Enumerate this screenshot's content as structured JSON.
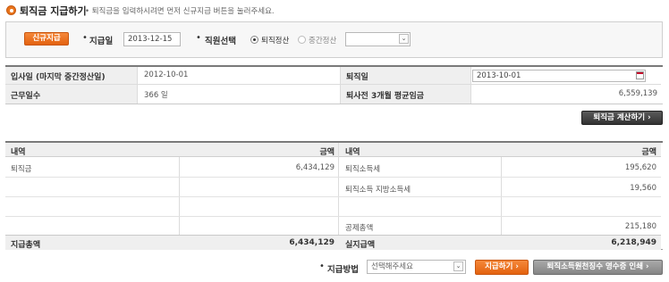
{
  "header": {
    "title": "퇴직금 지급하기",
    "description": "• 퇴직금을 입력하시려면 먼저 신규지급 버튼을 눌러주세요."
  },
  "search": {
    "new_payment_button": "신규지급",
    "pay_date_label": "지급일",
    "pay_date_value": "2013-12-15",
    "employee_select_label": "직원선택",
    "radio_retirement": "퇴직정산",
    "radio_interim": "중간정산",
    "employee_dropdown_value": ""
  },
  "info": {
    "join_date_label": "입사일 (마지막 중간정산일)",
    "join_date_value": "2012-10-01",
    "retire_date_label": "퇴직일",
    "retire_date_value": "2013-10-01",
    "service_days_label": "근무일수",
    "service_days_value": "366 일",
    "avg_wage_label": "퇴사전 3개월 평균임금",
    "avg_wage_value": "6,559,139",
    "calc_button": "퇴직금 계산하기"
  },
  "detail": {
    "left_headers": [
      "내역",
      "금액"
    ],
    "right_headers": [
      "내역",
      "금액"
    ],
    "left_rows": [
      {
        "item": "퇴직금",
        "amount": "6,434,129"
      },
      {
        "item": "",
        "amount": ""
      },
      {
        "item": "",
        "amount": ""
      },
      {
        "item": "",
        "amount": ""
      }
    ],
    "right_rows": [
      {
        "item": "퇴직소득세",
        "amount": "195,620"
      },
      {
        "item": "퇴직소득 지방소득세",
        "amount": "19,560"
      },
      {
        "item": "",
        "amount": ""
      },
      {
        "item": "공제총액",
        "amount": "215,180"
      }
    ],
    "left_total_label": "지급총액",
    "left_total_value": "6,434,129",
    "right_total_label": "실지급액",
    "right_total_value": "6,218,949"
  },
  "footer": {
    "pay_method_label": "지급방법",
    "pay_method_placeholder": "선택해주세요",
    "pay_button": "지급하기",
    "receipt_button": "퇴직소득원천징수 영수증 인쇄"
  },
  "colors": {
    "accent": "#e3620f",
    "dark_button": "#333333",
    "gray_button": "#858585"
  }
}
